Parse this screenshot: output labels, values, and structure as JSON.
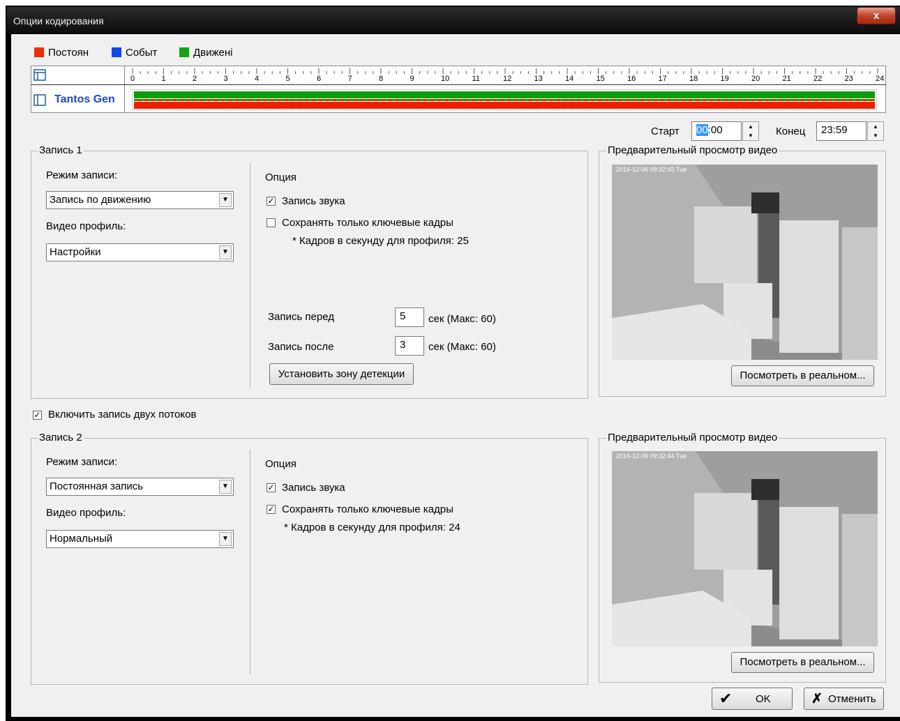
{
  "window": {
    "title": "Опции кодирования",
    "close_symbol": "x"
  },
  "legend": [
    {
      "label": "Постоян",
      "color": "#ee2d00"
    },
    {
      "label": "Событ",
      "color": "#1146f0"
    },
    {
      "label": "Движені",
      "color": "#15a315"
    }
  ],
  "timeline": {
    "hours": [
      "0",
      "1",
      "2",
      "3",
      "4",
      "5",
      "6",
      "7",
      "8",
      "9",
      "10",
      "11",
      "12",
      "13",
      "14",
      "15",
      "16",
      "17",
      "18",
      "19",
      "20",
      "21",
      "22",
      "23",
      "24"
    ],
    "camera_name": "Tantos Gen"
  },
  "time_range": {
    "start_label": "Старт",
    "start_hh": "00",
    "start_mm": ":00",
    "end_label": "Конец",
    "end_value": "23:59"
  },
  "record1": {
    "group_label": "Запись 1",
    "mode_label": "Режим записи:",
    "mode_value": "Запись по движению",
    "profile_label": "Видео профиль:",
    "profile_value": "Настройки",
    "option_label": "Опция",
    "audio_label": "Запись звука",
    "audio_checked": true,
    "keyframes_label": "Сохранять только ключевые кадры",
    "keyframes_checked": false,
    "fps_note": "* Кадров в секунду для профиля: 25",
    "pre_label": "Запись перед",
    "pre_value": "5",
    "pre_unit": "сек  (Макс: 60)",
    "post_label": "Запись после",
    "post_value": "3",
    "post_unit": "сек  (Макс: 60)",
    "zone_button": "Установить зону детекции"
  },
  "preview1": {
    "label": "Предварительный просмотр видео",
    "button": "Посмотреть в реальном...",
    "overlay": "2016-12-06 09:32:45 Tue"
  },
  "dual_stream": {
    "label": "Включить запись двух потоков",
    "checked": true
  },
  "record2": {
    "group_label": "Запись 2",
    "mode_label": "Режим записи:",
    "mode_value": "Постоянная запись",
    "profile_label": "Видео профиль:",
    "profile_value": "Нормальный",
    "option_label": "Опция",
    "audio_label": "Запись звука",
    "audio_checked": true,
    "keyframes_label": "Сохранять только ключевые кадры",
    "keyframes_checked": true,
    "fps_note": "* Кадров в секунду для профиля: 24"
  },
  "preview2": {
    "label": "Предварительный просмотр видео",
    "button": "Посмотреть в реальном...",
    "overlay": "2016-12-06 09:32:44 Tue"
  },
  "footer": {
    "ok_label": "OK",
    "cancel_label": "Отменить"
  }
}
